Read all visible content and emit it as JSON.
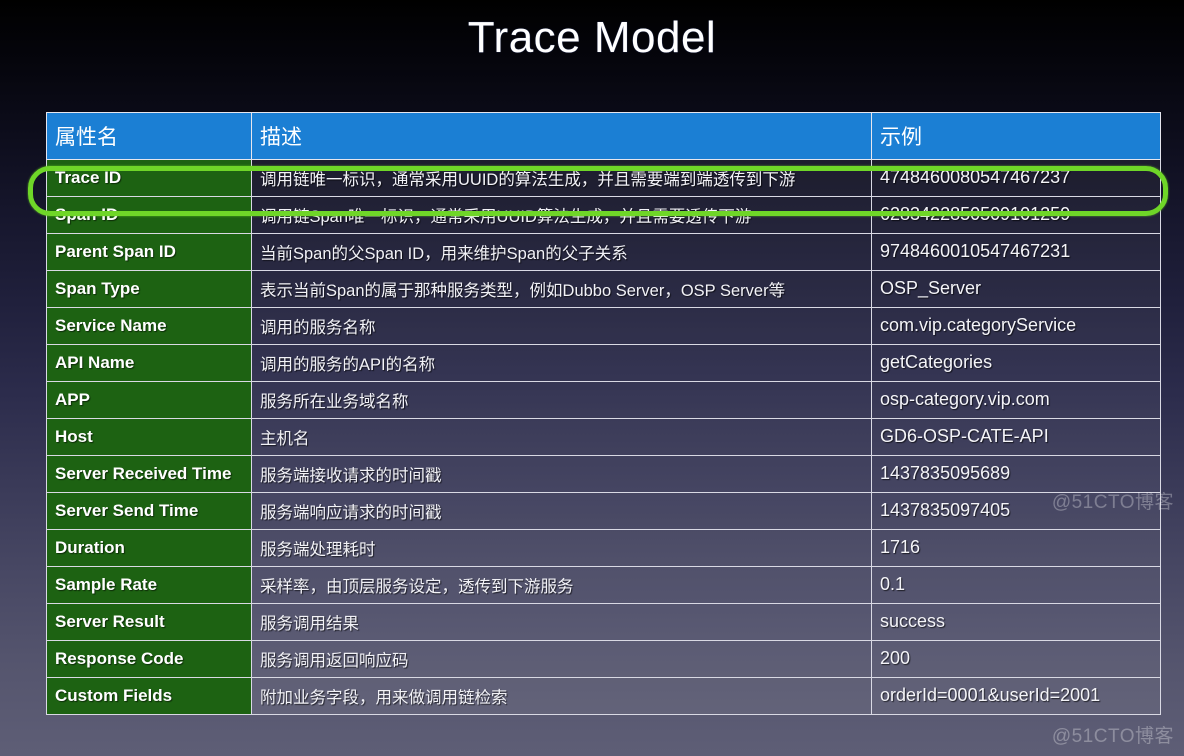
{
  "slide": {
    "title": "Trace Model",
    "accent_blue": "#1b7fd4",
    "accent_green": "#1d6212",
    "highlight_green": "#6fd628"
  },
  "table": {
    "headers": [
      "属性名",
      "描述",
      "示例"
    ],
    "rows": [
      {
        "attribute": "Trace ID",
        "description": "调用链唯一标识，通常采用UUID的算法生成，并且需要端到端透传到下游",
        "example": "4748460080547467237",
        "highlighted": true
      },
      {
        "attribute": "Span ID",
        "description": "调用链Span唯一标识，通常采用UUID算法生成，并且需要透传下游",
        "example": "6283422850509101259",
        "highlighted": false
      },
      {
        "attribute": "Parent Span ID",
        "description": "当前Span的父Span ID，用来维护Span的父子关系",
        "example": "9748460010547467231",
        "highlighted": false
      },
      {
        "attribute": "Span Type",
        "description": "表示当前Span的属于那种服务类型，例如Dubbo Server，OSP Server等",
        "example": "OSP_Server",
        "highlighted": false
      },
      {
        "attribute": "Service Name",
        "description": "调用的服务名称",
        "example": "com.vip.categoryService",
        "highlighted": false
      },
      {
        "attribute": "API Name",
        "description": "调用的服务的API的名称",
        "example": "getCategories",
        "highlighted": false
      },
      {
        "attribute": "APP",
        "description": "服务所在业务域名称",
        "example": "osp-category.vip.com",
        "highlighted": false
      },
      {
        "attribute": "Host",
        "description": "主机名",
        "example": "GD6-OSP-CATE-API",
        "highlighted": false
      },
      {
        "attribute": "Server Received Time",
        "description": "服务端接收请求的时间戳",
        "example": "1437835095689",
        "highlighted": false
      },
      {
        "attribute": "Server Send Time",
        "description": "服务端响应请求的时间戳",
        "example": "1437835097405",
        "highlighted": false
      },
      {
        "attribute": "Duration",
        "description": "服务端处理耗时",
        "example": "1716",
        "highlighted": false
      },
      {
        "attribute": "Sample Rate",
        "description": "采样率，由顶层服务设定，透传到下游服务",
        "example": "0.1",
        "highlighted": false
      },
      {
        "attribute": "Server Result",
        "description": "服务调用结果",
        "example": "success",
        "highlighted": false
      },
      {
        "attribute": "Response Code",
        "description": "服务调用返回响应码",
        "example": "200",
        "highlighted": false
      },
      {
        "attribute": "Custom Fields",
        "description": "附加业务字段，用来做调用链检索",
        "example": "orderId=0001&userId=2001",
        "highlighted": false
      }
    ]
  },
  "watermarks": {
    "middle": "@51CTO博客",
    "bottom": "@51CTO博客"
  }
}
